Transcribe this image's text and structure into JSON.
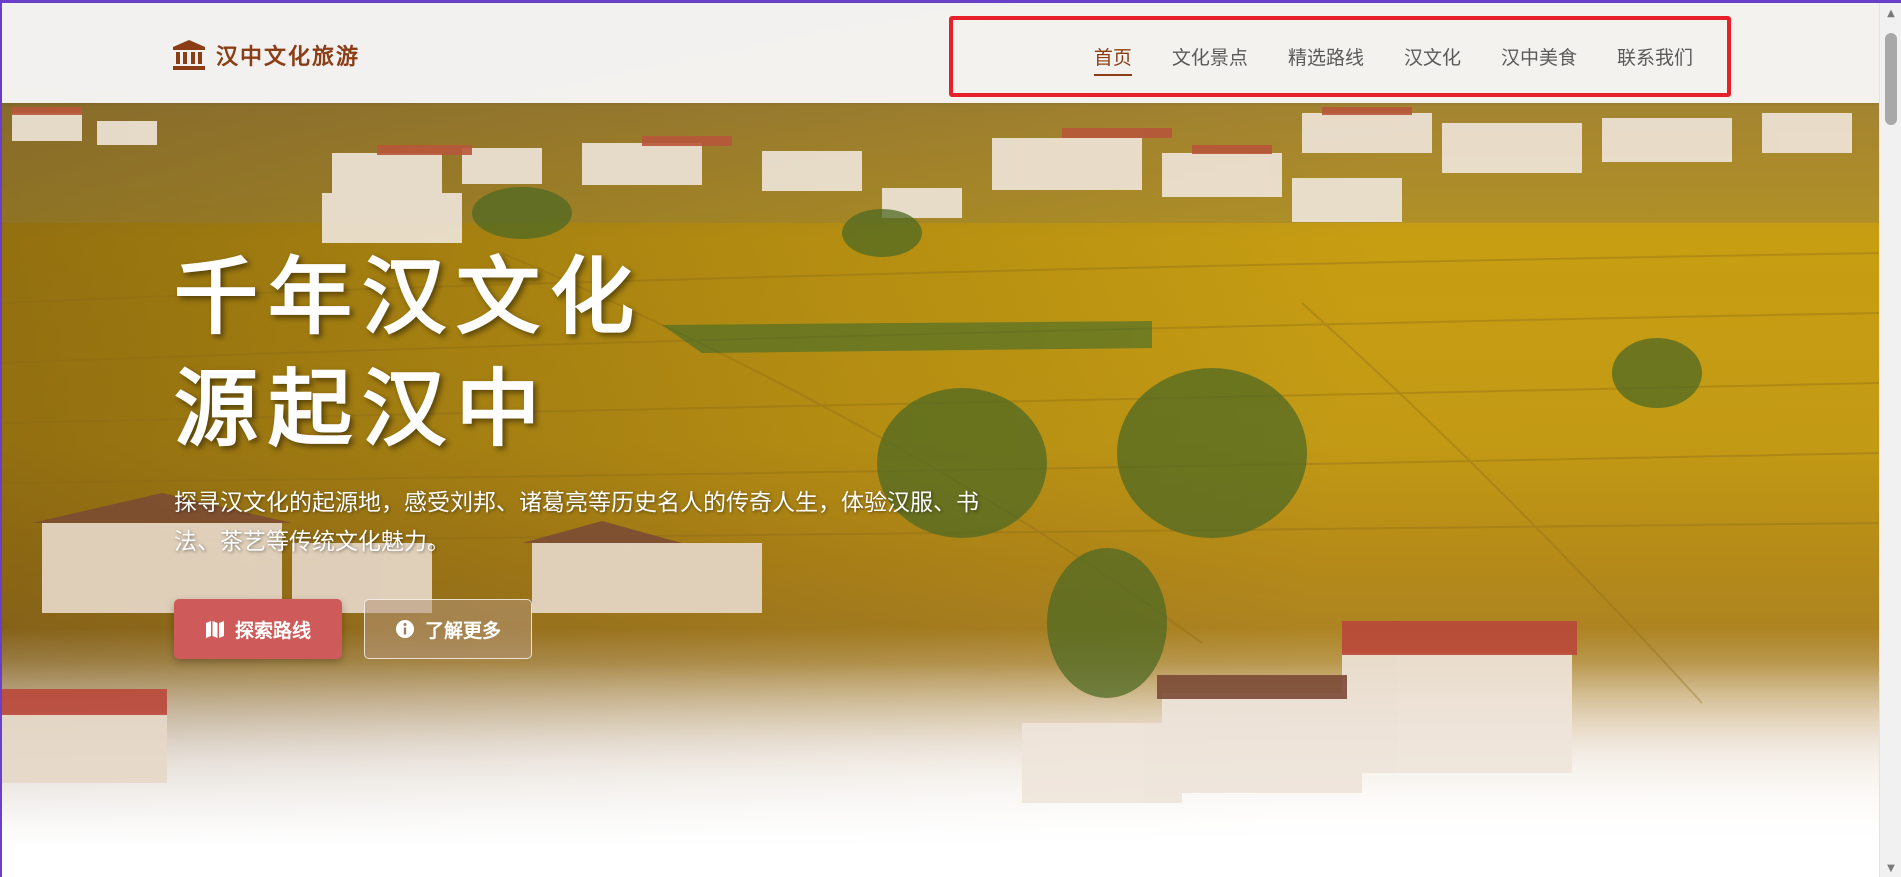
{
  "header": {
    "logo_text": "汉中文化旅游",
    "logo_icon": "landmark-icon",
    "nav": [
      {
        "label": "首页",
        "active": true
      },
      {
        "label": "文化景点",
        "active": false
      },
      {
        "label": "精选路线",
        "active": false
      },
      {
        "label": "汉文化",
        "active": false
      },
      {
        "label": "汉中美食",
        "active": false
      },
      {
        "label": "联系我们",
        "active": false
      }
    ]
  },
  "hero": {
    "title_line1": "千年汉文化",
    "title_line2": "源起汉中",
    "description": "探寻汉文化的起源地，感受刘邦、诸葛亮等历史名人的传奇人生，体验汉服、书法、茶艺等传统文化魅力。",
    "primary_button": {
      "label": "探索路线",
      "icon": "map-icon"
    },
    "secondary_button": {
      "label": "了解更多",
      "icon": "info-circle-icon"
    }
  },
  "colors": {
    "brand": "#8b3d15",
    "primary_button": "#cf5a5a",
    "highlight_box": "#e8202a",
    "nav_text": "#5a5a5a"
  }
}
